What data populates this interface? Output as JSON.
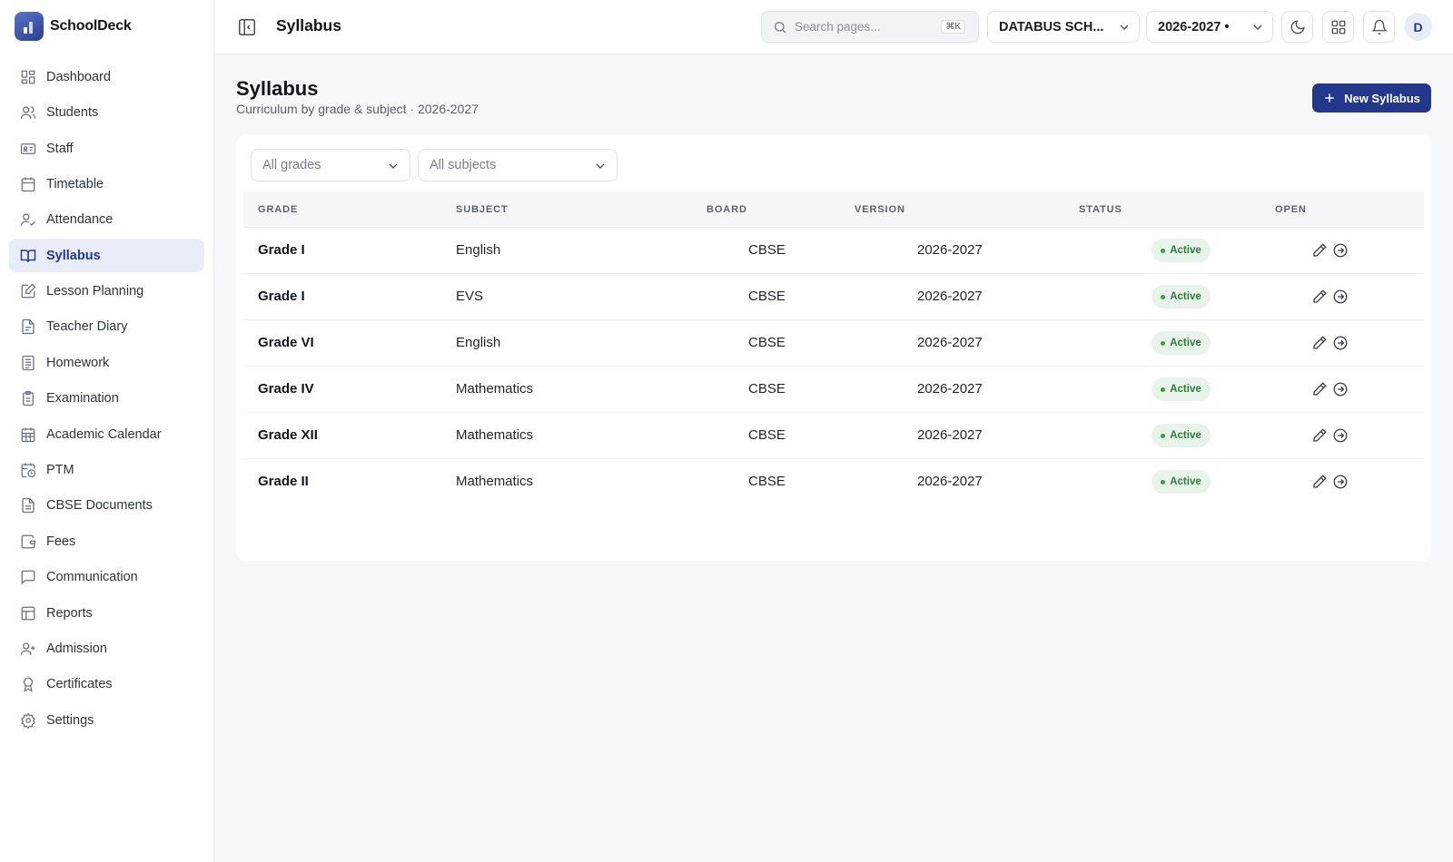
{
  "brand": {
    "name": "SchoolDeck"
  },
  "sidebar": {
    "items": [
      {
        "label": "Dashboard",
        "icon": "dashboard-icon"
      },
      {
        "label": "Students",
        "icon": "users-icon"
      },
      {
        "label": "Staff",
        "icon": "id-card-icon"
      },
      {
        "label": "Timetable",
        "icon": "calendar-icon"
      },
      {
        "label": "Attendance",
        "icon": "user-check-icon"
      },
      {
        "label": "Syllabus",
        "icon": "book-icon",
        "active": true
      },
      {
        "label": "Lesson Planning",
        "icon": "edit-doc-icon"
      },
      {
        "label": "Teacher Diary",
        "icon": "notebook-icon"
      },
      {
        "label": "Homework",
        "icon": "list-doc-icon"
      },
      {
        "label": "Examination",
        "icon": "clipboard-icon"
      },
      {
        "label": "Academic Calendar",
        "icon": "calendar-grid-icon"
      },
      {
        "label": "PTM",
        "icon": "calendar-clock-icon"
      },
      {
        "label": "CBSE Documents",
        "icon": "document-icon"
      },
      {
        "label": "Fees",
        "icon": "wallet-icon"
      },
      {
        "label": "Communication",
        "icon": "message-icon"
      },
      {
        "label": "Reports",
        "icon": "table-icon"
      },
      {
        "label": "Admission",
        "icon": "user-plus-icon"
      },
      {
        "label": "Certificates",
        "icon": "award-icon"
      },
      {
        "label": "Settings",
        "icon": "gear-icon"
      }
    ]
  },
  "topbar": {
    "title": "Syllabus",
    "search_placeholder": "Search pages...",
    "search_shortcut": "⌘K",
    "school_select": "DATABUS SCH...",
    "year_select": "2026-2027 •",
    "avatar": "D"
  },
  "page": {
    "title": "Syllabus",
    "subtitle": "Curriculum by grade & subject · 2026-2027",
    "new_button": "New Syllabus"
  },
  "filters": {
    "grade": "All grades",
    "subject": "All subjects"
  },
  "table": {
    "columns": [
      "GRADE",
      "SUBJECT",
      "BOARD",
      "VERSION",
      "STATUS",
      "OPEN"
    ],
    "rows": [
      {
        "grade": "Grade I",
        "subject": "English",
        "board": "CBSE",
        "version": "2026-2027",
        "status": "Active"
      },
      {
        "grade": "Grade I",
        "subject": "EVS",
        "board": "CBSE",
        "version": "2026-2027",
        "status": "Active"
      },
      {
        "grade": "Grade VI",
        "subject": "English",
        "board": "CBSE",
        "version": "2026-2027",
        "status": "Active"
      },
      {
        "grade": "Grade IV",
        "subject": "Mathematics",
        "board": "CBSE",
        "version": "2026-2027",
        "status": "Active"
      },
      {
        "grade": "Grade XII",
        "subject": "Mathematics",
        "board": "CBSE",
        "version": "2026-2027",
        "status": "Active"
      },
      {
        "grade": "Grade II",
        "subject": "Mathematics",
        "board": "CBSE",
        "version": "2026-2027",
        "status": "Active"
      }
    ]
  },
  "colors": {
    "accent": "#24388b",
    "active_bg": "#e8edf8",
    "status_bg": "#e8f3ea",
    "status_text": "#2f7a3e"
  }
}
